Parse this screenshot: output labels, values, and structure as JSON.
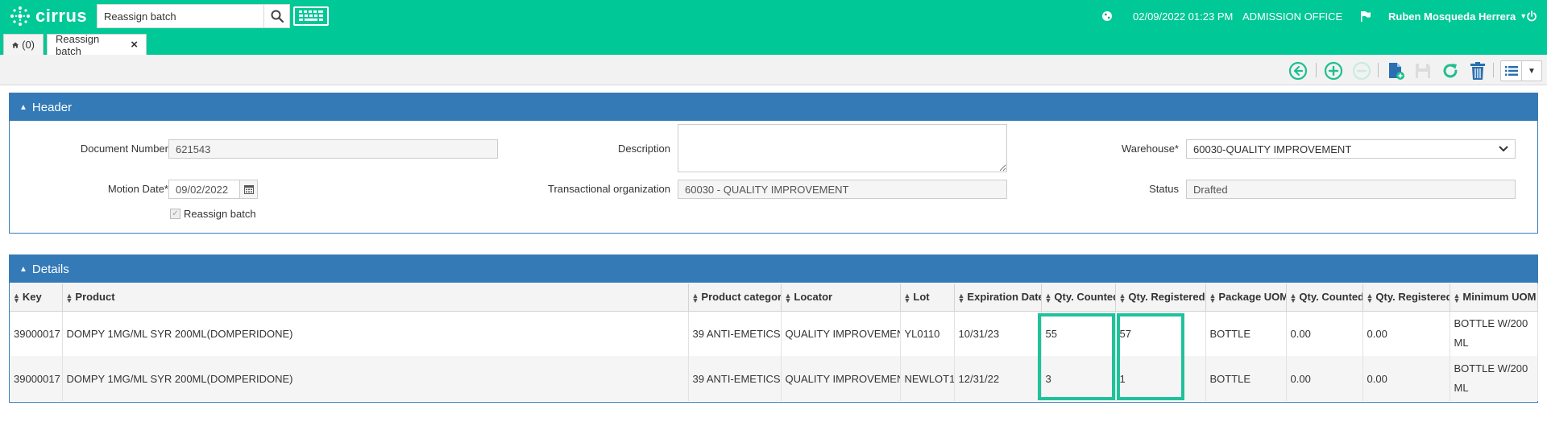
{
  "app": {
    "logo_text": "cirrus",
    "search_value": "Reassign batch",
    "datetime": "02/09/2022 01:23 PM",
    "office": "ADMISSION OFFICE",
    "user_name": "Ruben Mosqueda Herrera"
  },
  "tabs": {
    "home_count": "(0)",
    "active_label": "Reassign batch"
  },
  "header": {
    "title": "Header",
    "document_number_label": "Document Number",
    "document_number": "621543",
    "description_label": "Description",
    "description": "",
    "warehouse_label": "Warehouse*",
    "warehouse": "60030-QUALITY IMPROVEMENT",
    "motion_date_label": "Motion Date*",
    "motion_date": "09/02/2022",
    "transactional_org_label": "Transactional organization",
    "transactional_org": "60030 - QUALITY IMPROVEMENT",
    "status_label": "Status",
    "status": "Drafted",
    "reassign_batch_label": "Reassign batch",
    "reassign_batch_checked": true
  },
  "details": {
    "title": "Details",
    "columns": [
      "Key",
      "Product",
      "Product category",
      "Locator",
      "Lot",
      "Expiration Date",
      "Qty. Counted",
      "Qty. Registered",
      "Package UOM",
      "Qty. Counted",
      "Qty. Registered",
      "Minimum UOM"
    ],
    "rows": [
      [
        "39000017",
        "DOMPY 1MG/ML SYR 200ML(DOMPERIDONE)",
        "39 ANTI-EMETICS",
        "QUALITY IMPROVEMENT",
        "YL0110",
        "10/31/23",
        "55",
        "57",
        "BOTTLE",
        "0.00",
        "0.00",
        "BOTTLE W/200 ML"
      ],
      [
        "39000017",
        "DOMPY 1MG/ML SYR 200ML(DOMPERIDONE)",
        "39 ANTI-EMETICS",
        "QUALITY IMPROVEMENT",
        "NEWLOT1",
        "12/31/22",
        "3",
        "1",
        "BOTTLE",
        "0.00",
        "0.00",
        "BOTTLE W/200 ML"
      ]
    ]
  },
  "colors": {
    "brand": "#00c896",
    "panel_header": "#337ab7",
    "toolbar_icon": "#1fbf8f",
    "highlight": "#1fc29a"
  },
  "icons": {
    "search": "search-icon",
    "keyboard": "keyboard-icon",
    "globe": "globe-icon",
    "flag": "flag-icon",
    "power": "power-icon",
    "home": "home-icon",
    "back": "back-circle-icon",
    "add": "plus-circle-icon",
    "remove": "minus-circle-icon",
    "new_document": "new-document-icon",
    "save": "save-icon",
    "refresh": "refresh-icon",
    "delete": "trash-icon",
    "list": "list-icon",
    "calendar": "calendar-icon"
  }
}
